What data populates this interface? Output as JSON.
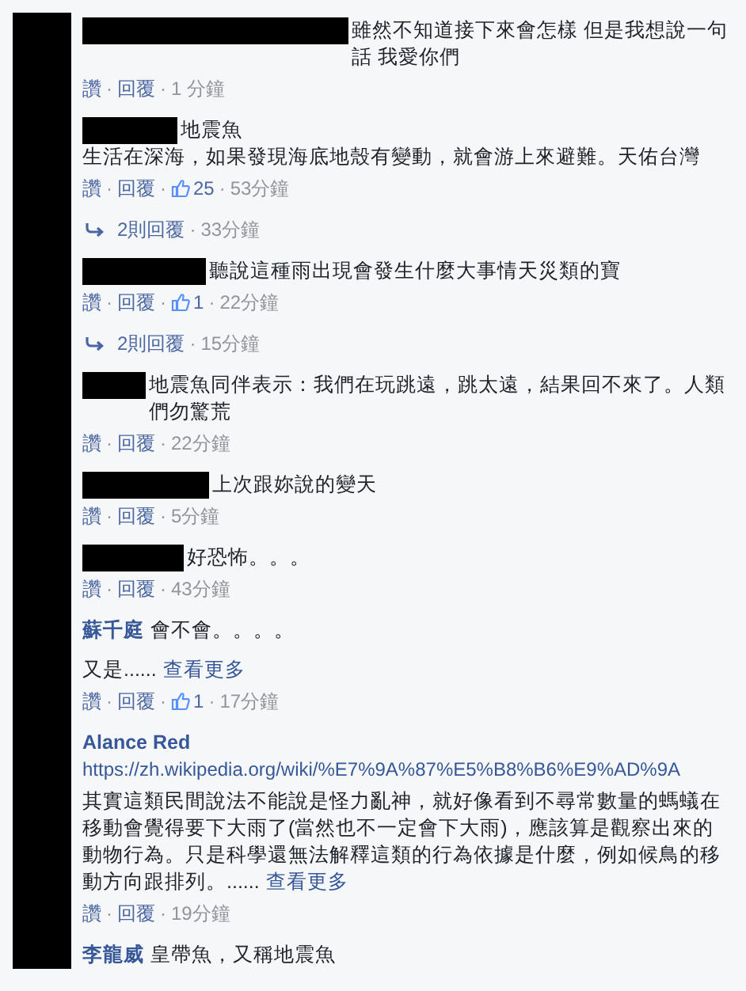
{
  "separator": "·",
  "comments": [
    {
      "name_redacted": true,
      "paragraphs": [
        {
          "kind": "text",
          "text": "雖然不知道接下來會怎樣 但是我想說一句話 我愛你們"
        }
      ],
      "actions": {
        "like": "讚",
        "reply": "回覆",
        "time": "1 分鐘"
      }
    },
    {
      "name_redacted": true,
      "paragraphs": [
        {
          "kind": "text",
          "text": "地震魚"
        },
        {
          "kind": "text",
          "text": "生活在深海，如果發現海底地殼有變動，就會游上來避難。天佑台灣"
        }
      ],
      "actions": {
        "like": "讚",
        "reply": "回覆",
        "likes": "25",
        "time": "53分鐘"
      },
      "replies": {
        "label": "2則回覆",
        "time": "33分鐘"
      }
    },
    {
      "name_redacted": true,
      "paragraphs": [
        {
          "kind": "text",
          "text": "聽說這種雨出現會發生什麼大事情天災類的寶"
        }
      ],
      "actions": {
        "like": "讚",
        "reply": "回覆",
        "likes": "1",
        "time": "22分鐘"
      },
      "replies": {
        "label": "2則回覆",
        "time": "15分鐘"
      }
    },
    {
      "name_redacted": true,
      "paragraphs": [
        {
          "kind": "text",
          "text": "地震魚同伴表示：我們在玩跳遠，跳太遠，結果回不來了。人類們勿驚荒"
        }
      ],
      "actions": {
        "like": "讚",
        "reply": "回覆",
        "time": "22分鐘"
      }
    },
    {
      "name_redacted": true,
      "paragraphs": [
        {
          "kind": "text",
          "text": "上次跟妳說的變天"
        }
      ],
      "actions": {
        "like": "讚",
        "reply": "回覆",
        "time": "5分鐘"
      }
    },
    {
      "name_redacted": true,
      "paragraphs": [
        {
          "kind": "text",
          "text": "好恐怖。。。"
        }
      ],
      "actions": {
        "like": "讚",
        "reply": "回覆",
        "time": "43分鐘"
      }
    },
    {
      "name_redacted": false,
      "name": "蘇千庭",
      "paragraphs": [
        {
          "kind": "text",
          "text": "會不會。。。。"
        },
        {
          "kind": "text",
          "text": "又是......",
          "more": "查看更多"
        }
      ],
      "actions": {
        "like": "讚",
        "reply": "回覆",
        "likes": "1",
        "time": "17分鐘"
      }
    },
    {
      "name_redacted": false,
      "name": "Alance Red",
      "paragraphs": [
        {
          "kind": "url",
          "text": "https://zh.wikipedia.org/wiki/%E7%9A%87%E5%B8%B6%E9%AD%9A"
        },
        {
          "kind": "text",
          "text": "其實這類民間說法不能說是怪力亂神，就好像看到不尋常數量的螞蟻在移動會覺得要下大雨了(當然也不一定會下大雨)，應該算是觀察出來的動物行為。只是科學還無法解釋這類的行為依據是什麼，例如候鳥的移動方向跟排列。......",
          "more": "查看更多"
        }
      ],
      "actions": {
        "like": "讚",
        "reply": "回覆",
        "time": "19分鐘"
      }
    },
    {
      "name_redacted": false,
      "name": "李龍威",
      "paragraphs": [
        {
          "kind": "text",
          "text": "皇帶魚，又稱地震魚"
        }
      ]
    }
  ]
}
